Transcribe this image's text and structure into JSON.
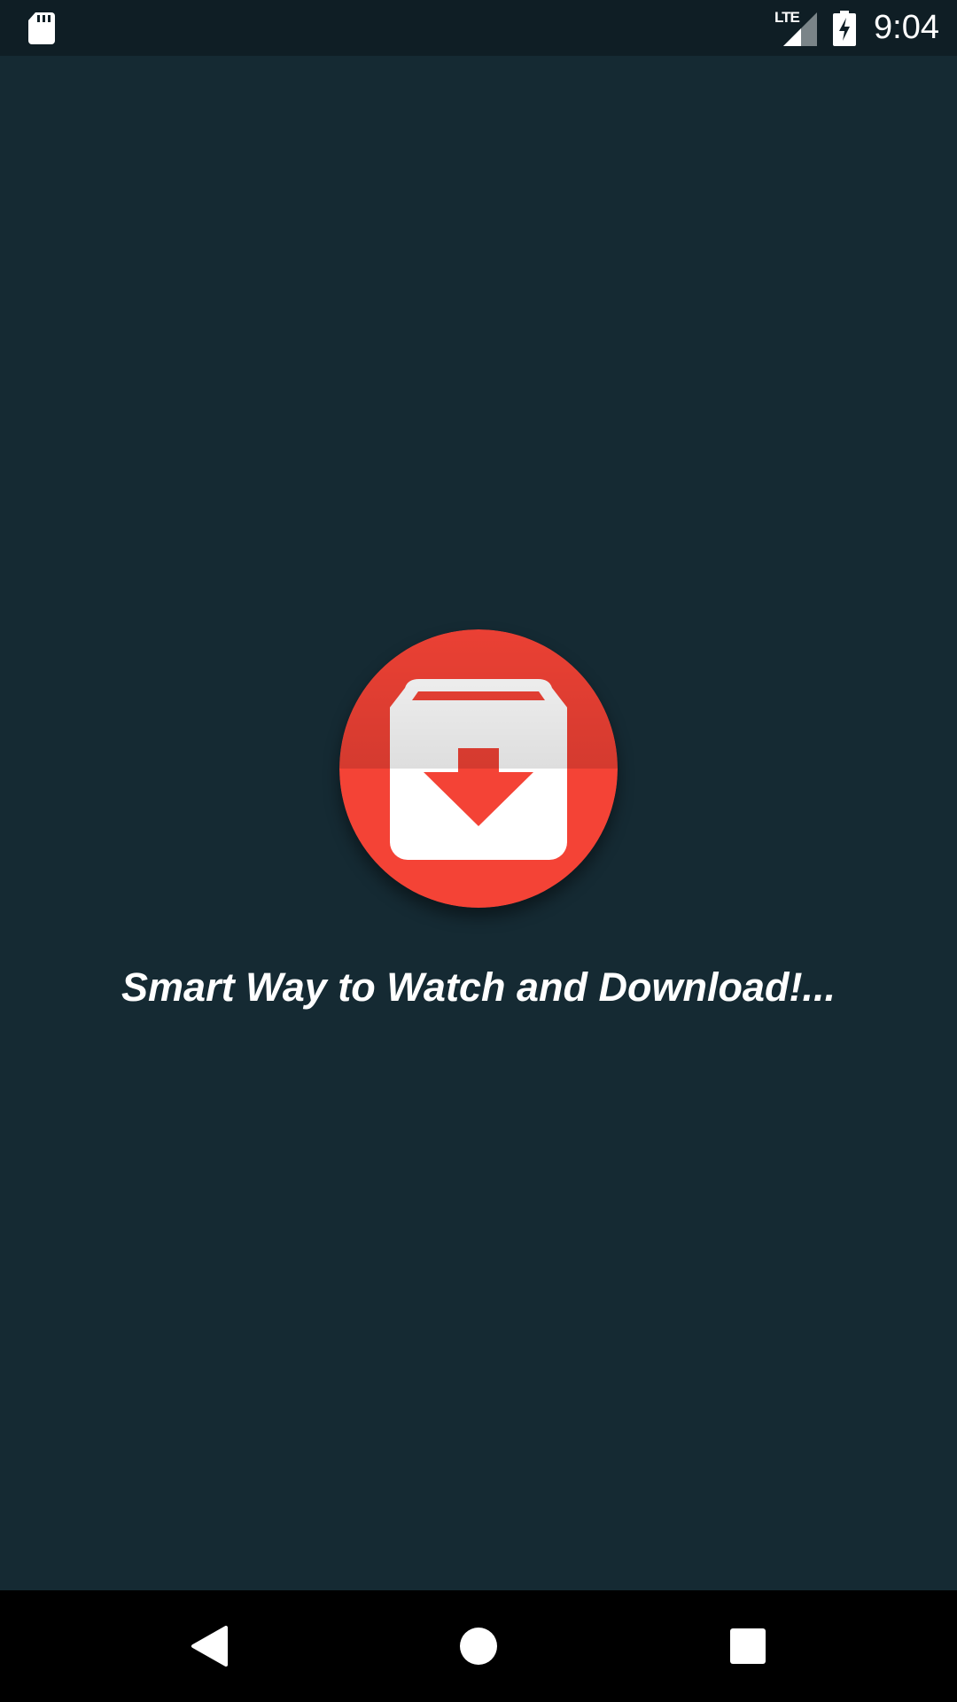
{
  "status_bar": {
    "left_icon": "sd-card-icon",
    "network_label": "LTE",
    "signal_icon": "signal-icon",
    "battery_icon": "battery-charging-icon",
    "time": "9:04"
  },
  "splash": {
    "logo_icon": "download-box-icon",
    "tagline": "Smart Way to Watch and Download!..."
  },
  "nav_bar": {
    "back_icon": "back-triangle-icon",
    "home_icon": "home-circle-icon",
    "recents_icon": "recents-square-icon"
  },
  "colors": {
    "background": "#152a33",
    "status_bar": "#0f1e25",
    "logo_red": "#f44336",
    "logo_white": "#ffffff"
  }
}
